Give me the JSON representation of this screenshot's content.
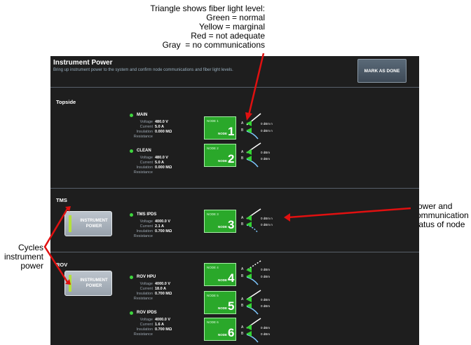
{
  "annotations": {
    "top": [
      "Triangle shows fiber light level:",
      "Green = normal",
      "Yellow = marginal",
      "Red = not adequate",
      "Gray  = no communications"
    ],
    "right": [
      "Power and",
      "communication",
      "status of node"
    ],
    "left": [
      "Cycles",
      "instrument",
      "power"
    ]
  },
  "header": {
    "title": "Instrument Power",
    "subtitle": "Bring up instrument power to the system and confirm node communications and fiber light levels.",
    "mark_done": "MARK AS DONE"
  },
  "labels": {
    "voltage": "Voltage",
    "current": "Current",
    "insulation": "Insulation",
    "resistance": "Resistance",
    "node_word": "NODE",
    "link_a": "A",
    "link_b": "B"
  },
  "sections": {
    "topside": {
      "title": "Topside"
    },
    "tms": {
      "title": "TMS",
      "power_button": "INSTRUMENT POWER"
    },
    "rov": {
      "title": "ROV",
      "power_button": "INSTRUMENT POWER"
    }
  },
  "circuits": {
    "main": {
      "name": "MAIN",
      "voltage": "480.0 V",
      "current": "5.0 A",
      "insulation": "0.000 MΩ"
    },
    "clean": {
      "name": "CLEAN",
      "voltage": "480.0 V",
      "current": "5.0 A",
      "insulation": "0.000 MΩ"
    },
    "tms_ipds": {
      "name": "TMS IPDS",
      "voltage": "4000.0 V",
      "current": "2.1 A",
      "insulation": "0.700 MΩ"
    },
    "rov_hpu": {
      "name": "ROV HPU",
      "voltage": "4000.0 V",
      "current": "18.0 A",
      "insulation": "0.700 MΩ"
    },
    "rov_ipds": {
      "name": "ROV IPDS",
      "voltage": "4000.0 V",
      "current": "1.6 A",
      "insulation": "0.700 MΩ"
    }
  },
  "nodes": {
    "n1": {
      "name": "NODE 1",
      "num": "1",
      "a": "0 dBm n",
      "b": "0 dBm n",
      "a_level": "normal",
      "b_level": "normal"
    },
    "n2": {
      "name": "NODE 2",
      "num": "2",
      "a": "0 dBm",
      "b": "0 dBm",
      "a_level": "normal",
      "b_level": "normal"
    },
    "n3": {
      "name": "NODE 3",
      "num": "3",
      "a": "0 dBm n",
      "b": "0 dBm n",
      "a_level": "normal",
      "b_level": "normal"
    },
    "n4": {
      "name": "NODE 4",
      "num": "4",
      "a": "0 dBm",
      "b": "0 dBm",
      "a_level": "normal",
      "b_level": "normal"
    },
    "n5": {
      "name": "NODE 5",
      "num": "5",
      "a": "0 dBm",
      "b": "0 dBm",
      "a_level": "normal",
      "b_level": "normal"
    },
    "n6": {
      "name": "NODE 6",
      "num": "6",
      "a": "0 dBm",
      "b": "0 dBm",
      "a_level": "normal",
      "b_level": "normal"
    }
  },
  "colors": {
    "panel_bg": "#1e1e1e",
    "normal": "#33d433",
    "marginal": "#e8d83a",
    "not_adequate": "#e03030",
    "no_comm": "#8a8a8a",
    "arrow": "#e01010"
  }
}
